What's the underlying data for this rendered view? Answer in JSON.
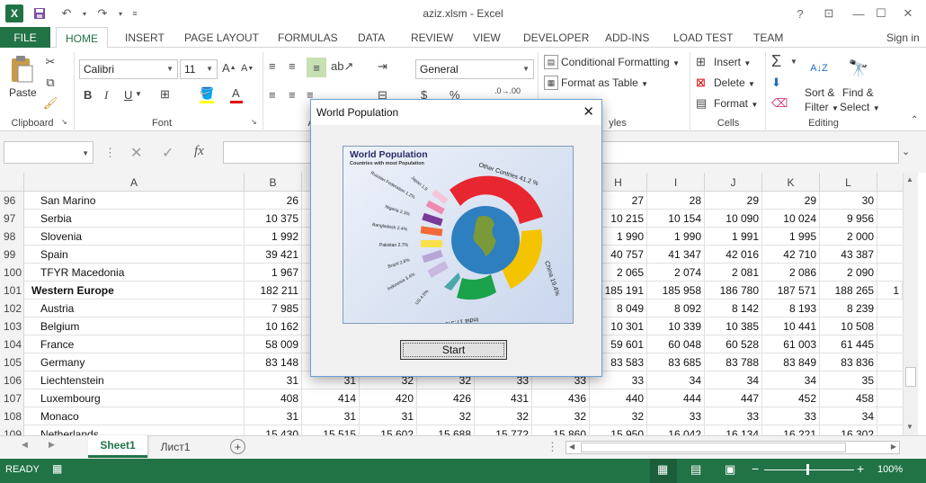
{
  "window": {
    "title": "aziz.xlsm - Excel",
    "sign_in": "Sign in",
    "help": "?"
  },
  "tabs": [
    "FILE",
    "HOME",
    "INSERT",
    "PAGE LAYOUT",
    "FORMULAS",
    "DATA",
    "REVIEW",
    "VIEW",
    "DEVELOPER",
    "ADD-INS",
    "LOAD TEST",
    "TEAM"
  ],
  "ribbon": {
    "clipboard": {
      "paste": "Paste",
      "label": "Clipboard"
    },
    "font": {
      "family": "Calibri",
      "size": "11",
      "label": "Font",
      "bold": "B",
      "italic": "I",
      "underline": "U",
      "grow": "A",
      "shrink": "A"
    },
    "alignment": {
      "label": "A"
    },
    "number": {
      "format": "General",
      "currency": "$",
      "percent": "%"
    },
    "styles": {
      "conditional": "Conditional Formatting",
      "format_table": "Format as Table",
      "label": "yles"
    },
    "cells": {
      "insert": "Insert",
      "delete": "Delete",
      "format": "Format",
      "label": "Cells"
    },
    "editing": {
      "sort": "Sort &",
      "filter": "Filter",
      "find": "Find &",
      "select": "Select",
      "label": "Editing"
    }
  },
  "formula_bar": {
    "name_box": "",
    "fx": "fx",
    "value": ""
  },
  "grid": {
    "columns": [
      "A",
      "B",
      "C",
      "D",
      "E",
      "F",
      "G",
      "H",
      "I",
      "J",
      "K",
      "L"
    ],
    "rows": [
      {
        "n": "96",
        "a": "San Marino",
        "b": "26",
        "h": "27",
        "i": "28",
        "j": "29",
        "k": "29",
        "l": "30",
        "bold": false
      },
      {
        "n": "97",
        "a": "Serbia",
        "b": "10 375",
        "h": "10 215",
        "i": "10 154",
        "j": "10 090",
        "k": "10 024",
        "l": "9 956",
        "bold": false
      },
      {
        "n": "98",
        "a": "Slovenia",
        "b": "1 992",
        "h": "1 990",
        "i": "1 990",
        "j": "1 991",
        "k": "1 995",
        "l": "2 000",
        "bold": false
      },
      {
        "n": "99",
        "a": "Spain",
        "b": "39 421",
        "h": "40 757",
        "i": "41 347",
        "j": "42 016",
        "k": "42 710",
        "l": "43 387",
        "bold": false
      },
      {
        "n": "100",
        "a": "TFYR Macedonia",
        "b": "1 967",
        "h": "2 065",
        "i": "2 074",
        "j": "2 081",
        "k": "2 086",
        "l": "2 090",
        "bold": false
      },
      {
        "n": "101",
        "a": "Western Europe",
        "b": "182 211",
        "h": "185 191",
        "i": "185 958",
        "j": "186 780",
        "k": "187 571",
        "l": "188 265",
        "bold": true
      },
      {
        "n": "102",
        "a": "Austria",
        "b": "7 985",
        "h": "8 049",
        "i": "8 092",
        "j": "8 142",
        "k": "8 193",
        "l": "8 239",
        "bold": false
      },
      {
        "n": "103",
        "a": "Belgium",
        "b": "10 162",
        "h": "10 301",
        "i": "10 339",
        "j": "10 385",
        "k": "10 441",
        "l": "10 508",
        "bold": false
      },
      {
        "n": "104",
        "a": "France",
        "b": "58 009",
        "h": "59 601",
        "i": "60 048",
        "j": "60 528",
        "k": "61 003",
        "l": "61 445",
        "bold": false
      },
      {
        "n": "105",
        "a": "Germany",
        "b": "83 148",
        "h": "83 583",
        "i": "83 685",
        "j": "83 788",
        "k": "83 849",
        "l": "83 836",
        "bold": false
      },
      {
        "n": "106",
        "a": "Liechtenstein",
        "b": "31",
        "c": "31",
        "d": "32",
        "e": "32",
        "f": "33",
        "g": "33",
        "h": "33",
        "i": "34",
        "j": "34",
        "k": "34",
        "l": "35",
        "bold": false
      },
      {
        "n": "107",
        "a": "Luxembourg",
        "b": "408",
        "c": "414",
        "d": "420",
        "e": "426",
        "f": "431",
        "g": "436",
        "h": "440",
        "i": "444",
        "j": "447",
        "k": "452",
        "l": "458",
        "bold": false
      },
      {
        "n": "108",
        "a": "Monaco",
        "b": "31",
        "c": "31",
        "d": "31",
        "e": "32",
        "f": "32",
        "g": "32",
        "h": "32",
        "i": "33",
        "j": "33",
        "k": "33",
        "l": "34",
        "bold": false
      },
      {
        "n": "109",
        "a": "Netherlands",
        "b": "15 430",
        "c": "15 515",
        "d": "15 602",
        "e": "15 688",
        "f": "15 772",
        "g": "15 860",
        "h": "15 950",
        "i": "16 042",
        "j": "16 134",
        "k": "16 221",
        "l": "16 302",
        "bold": false
      }
    ],
    "extra_m101": "1"
  },
  "sheets": {
    "active": "Sheet1",
    "other": "Лист1"
  },
  "status": {
    "mode": "READY",
    "zoom": "100%"
  },
  "dialog": {
    "title": "World Population",
    "image": {
      "heading": "World Population",
      "subheading": "Countries with most Population",
      "labels": [
        "Other Contries 41.2 %",
        "China 19.4%",
        "India 17.5%",
        "US 4.5%",
        "Indonesia 3.4%",
        "Brazil 2.8%",
        "Pakistan 2.7%",
        "Bangladesh 2.4%",
        "Nigeria 2.3%",
        "Russian Federation 1.2%",
        "Japan 1.9"
      ],
      "colors": {
        "other": "#e8262f",
        "china": "#f5c400",
        "india": "#1aa34a",
        "us": "#4aa8a8",
        "indonesia": "#c9b8e0",
        "brazil": "#b7a6d8",
        "pakistan": "#f8e04a",
        "bangladesh": "#f26a3a",
        "nigeria": "#7a3a9a",
        "russia": "#f08ab0",
        "japan": "#f4c6d8"
      }
    },
    "start": "Start"
  },
  "colors": {
    "excel_green": "#217346"
  }
}
